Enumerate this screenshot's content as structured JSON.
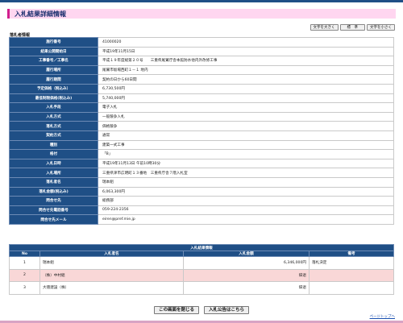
{
  "page": {
    "title": "入札結果詳細情報",
    "section_label": "落札者情報"
  },
  "font_controls": {
    "larger": "文字を大きく",
    "standard": "標　準",
    "smaller": "文字を小さく"
  },
  "info_rows": [
    {
      "label": "施行番号",
      "value": "41000020"
    },
    {
      "label": "結果公開開始日",
      "value": "平成19年11月15日"
    },
    {
      "label": "工事番号／工事名",
      "value": "平成１９年度総第２０号　　三重県尾鷲庁舎本館防水他内外改修工事"
    },
    {
      "label": "履行場所",
      "value": "尾鷲市坂場西町１－１ 地内"
    },
    {
      "label": "履行期間",
      "value": "契約の日から60日間"
    },
    {
      "label": "予定価格（税込み）",
      "value": "6,730,500円"
    },
    {
      "label": "最低制限価格(税込み)",
      "value": "5,740,000円"
    },
    {
      "label": "入札手段",
      "value": "電子入札"
    },
    {
      "label": "入札方式",
      "value": "一般競争入札"
    },
    {
      "label": "落札方式",
      "value": "価格競争"
    },
    {
      "label": "契約方式",
      "value": "通常"
    },
    {
      "label": "種別",
      "value": "建築一式工事"
    },
    {
      "label": "格付",
      "value": "「B」"
    },
    {
      "label": "入札日時",
      "value": "平成19年11月13日 午前10時30分"
    },
    {
      "label": "入札場所",
      "value": "三重県津市広明町１３番地　三重県庁舎７階入札室"
    },
    {
      "label": "落札者名",
      "value": "瑞本組"
    },
    {
      "label": "落札金額(税込み)",
      "value": "6,063,300円"
    },
    {
      "label": "問合せ先",
      "value": "総務部"
    },
    {
      "label": "問合せ先電話番号",
      "value": "059-224-2356"
    },
    {
      "label": "問合せ先メール",
      "value": "eiren@pref.mie.jp"
    }
  ],
  "results": {
    "caption": "入札結果情報",
    "headers": {
      "no": "No",
      "name": "入札者名",
      "amount": "入札金額",
      "note": "備考"
    },
    "rows": [
      {
        "no": "1",
        "name": "瑞本組",
        "amount": "6,346,000円",
        "note": "落札決定"
      },
      {
        "no": "2",
        "name": "（株）中村組",
        "amount": "辞退",
        "note": ""
      },
      {
        "no": "3",
        "name": "大徳建設（株）",
        "amount": "辞退",
        "note": ""
      }
    ]
  },
  "buttons": {
    "close": "この画面を閉じる",
    "notice": "入札公告はこちら"
  },
  "page_top_link": "ページトップへ",
  "colors": {
    "header_blue": "#1f4f86",
    "title_pink": "#ffd6f0",
    "title_accent": "#d11f8e",
    "row_pink": "#f9d7d7"
  }
}
